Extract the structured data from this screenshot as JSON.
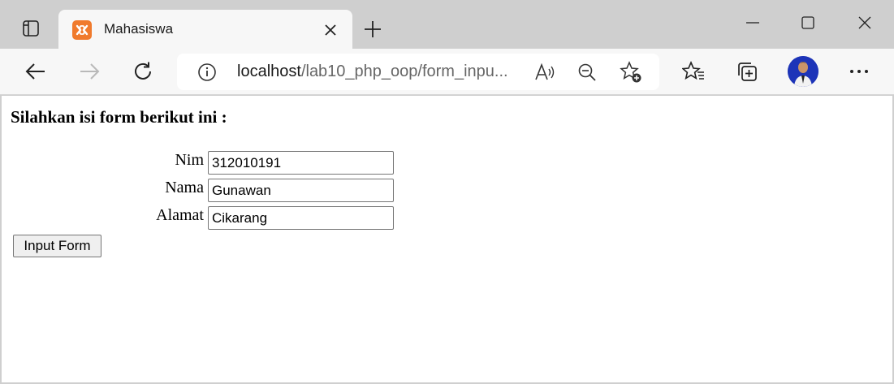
{
  "browser": {
    "tab": {
      "title": "Mahasiswa",
      "favicon": "xampp-icon"
    },
    "address_bar": {
      "url_host": "localhost",
      "url_path": "/lab10_php_oop/form_inpu...",
      "icons": [
        "info-icon",
        "read-aloud-icon",
        "zoom-out-icon",
        "add-favorite-icon"
      ]
    },
    "toolbar_icons": [
      "back-icon",
      "forward-icon",
      "refresh-icon",
      "favorites-icon",
      "collections-icon",
      "profile-avatar",
      "more-icon"
    ],
    "accent_color": "#f07a2c"
  },
  "page": {
    "heading": "Silahkan isi form berikut ini :",
    "fields": [
      {
        "label": "Nim",
        "value": "312010191"
      },
      {
        "label": "Nama",
        "value": "Gunawan"
      },
      {
        "label": "Alamat",
        "value": "Cikarang"
      }
    ],
    "submit_label": "Input Form"
  }
}
